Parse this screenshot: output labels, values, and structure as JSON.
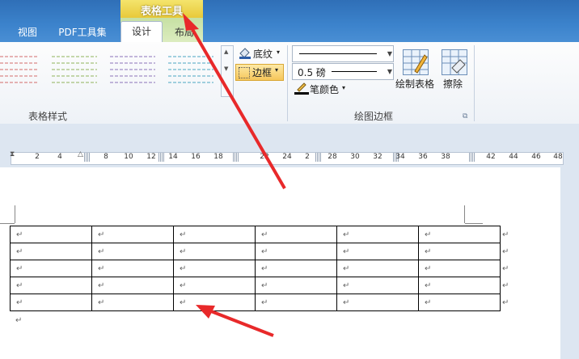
{
  "contextual_tab": {
    "label": "表格工具",
    "color": "#f4e46c"
  },
  "tabs": [
    {
      "label": "视图"
    },
    {
      "label": "PDF工具集"
    },
    {
      "label": "设计"
    },
    {
      "label": "布局"
    }
  ],
  "active_tab": "设计",
  "table_styles_group": {
    "label": "表格样式"
  },
  "shading": {
    "label": "底纹"
  },
  "borders": {
    "label": "边框"
  },
  "draw_borders_group": {
    "label": "绘图边框",
    "line_style": "",
    "line_weight": "0.5 磅",
    "pen_color_label": "笔颜色",
    "draw_table_label": "绘制表格",
    "eraser_label": "擦除"
  },
  "ruler": {
    "ticks": [
      "2",
      "4",
      "8",
      "10",
      "12",
      "14",
      "16",
      "18",
      "22",
      "24",
      "2",
      "28",
      "30",
      "32",
      "34",
      "36",
      "38",
      "42",
      "44",
      "46",
      "48"
    ]
  },
  "table": {
    "rows": 5,
    "cols": 6,
    "cell_mark": "↵"
  },
  "paragraph_mark": "↵",
  "annotation_color": "#e8292a"
}
